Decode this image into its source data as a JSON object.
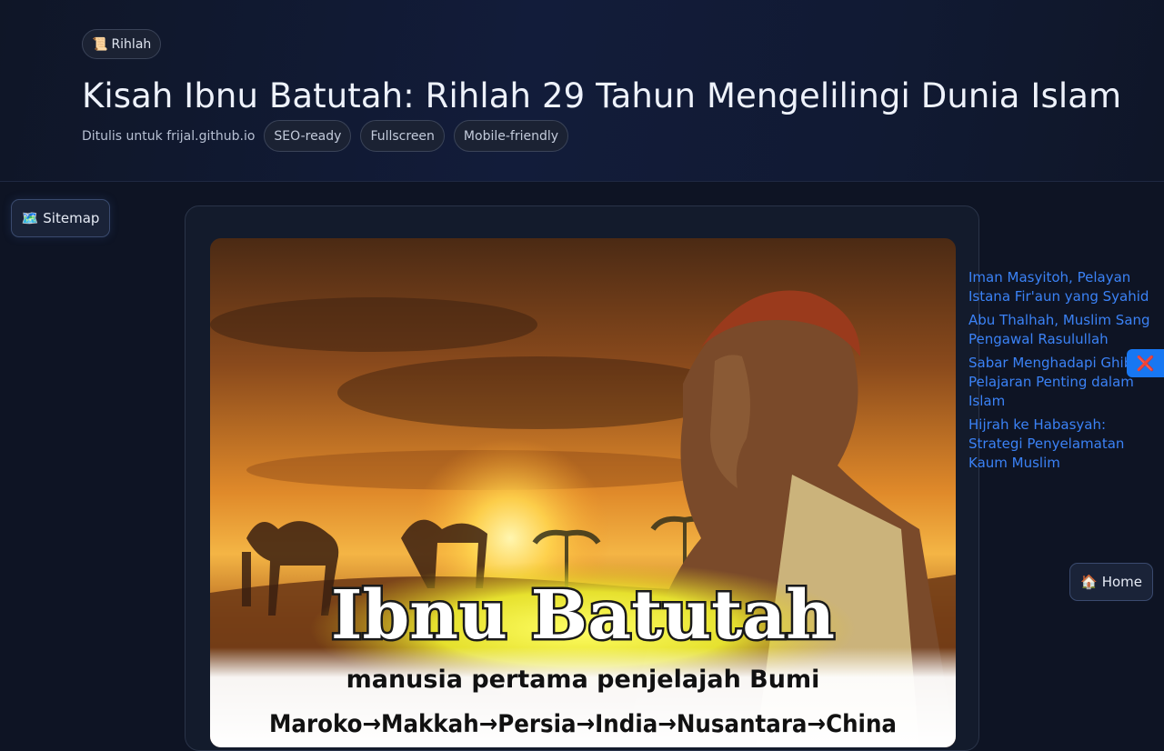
{
  "header": {
    "tag_icon": "📜",
    "tag_label": "Rihlah",
    "title": "Kisah Ibnu Batutah: Rihlah 29 Tahun Mengelilingi Dunia Islam",
    "byline": "Ditulis untuk frijal.github.io",
    "chips": [
      "SEO-ready",
      "Fullscreen",
      "Mobile-friendly"
    ]
  },
  "sitemap": {
    "icon": "🗺️",
    "label": "Sitemap"
  },
  "hero_image": {
    "headline": "Ibnu Batutah",
    "subtitle": "manusia pertama penjelajah Bumi",
    "route": "Maroko→Makkah→Persia→India→Nusantara→China"
  },
  "related_links": [
    "Iman Masyitoh, Pelayan Istana Fir'aun yang Syahid",
    "Abu Thalhah, Muslim Sang Pengawal Rasulullah",
    "Sabar Menghadapi Ghibah: Pelajaran Penting dalam Islam",
    "Hijrah ke Habasyah: Strategi Penyelamatan Kaum Muslim"
  ],
  "close_button": {
    "icon": "❌"
  },
  "home": {
    "icon": "🏠",
    "label": "Home"
  },
  "colors": {
    "link": "#3b82f6",
    "close_bg": "#1877f2",
    "page_bg": "#0e1424"
  }
}
